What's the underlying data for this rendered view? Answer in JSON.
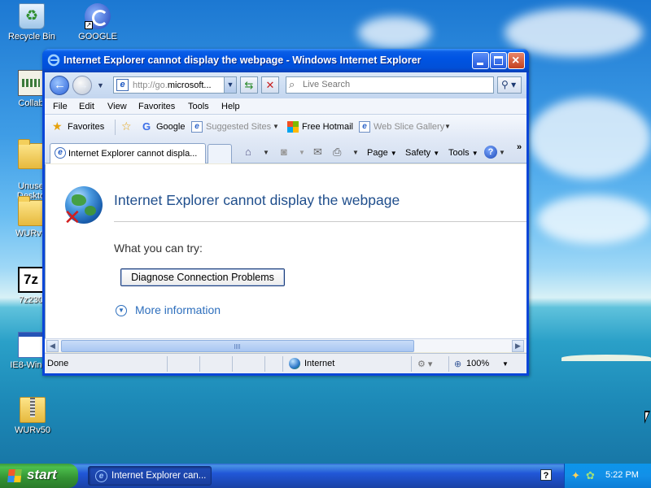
{
  "desktop": {
    "icons": [
      {
        "label": "Recycle Bin",
        "icon": "recycle-bin-icon"
      },
      {
        "label": "GOOGLE",
        "icon": "google-shortcut-icon"
      },
      {
        "label": "Collab",
        "icon": "collab-app-icon"
      },
      {
        "label": "Unuse\nDeskto",
        "icon": "folder-icon"
      },
      {
        "label": "WURv5",
        "icon": "folder-icon"
      },
      {
        "label": "7z230",
        "icon": "7zip-icon"
      },
      {
        "label": "IE8-Windo",
        "icon": "installer-icon"
      },
      {
        "label": "WURv50",
        "icon": "zip-folder-icon"
      }
    ]
  },
  "window": {
    "title": "Internet Explorer cannot display the webpage - Windows Internet Explorer",
    "buttons": {
      "minimize": "minimize-icon",
      "maximize": "maximize-icon",
      "close": "close-icon",
      "close_glyph": "×"
    },
    "address": {
      "url_prefix": "http://go.",
      "url_host": "microsoft...",
      "search_placeholder": "Live Search"
    },
    "menu": [
      "File",
      "Edit",
      "View",
      "Favorites",
      "Tools",
      "Help"
    ],
    "favorites_bar": {
      "favorites": "Favorites",
      "google": "Google",
      "suggested_sites": "Suggested Sites",
      "free_hotmail": "Free Hotmail",
      "web_slice_gallery": "Web Slice Gallery"
    },
    "tab": {
      "title": "Internet Explorer cannot displa..."
    },
    "command_bar": {
      "page": "Page",
      "safety": "Safety",
      "tools": "Tools",
      "more": "»"
    },
    "page": {
      "heading": "Internet Explorer cannot display the webpage",
      "try_label": "What you can try:",
      "diagnose_button": "Diagnose Connection Problems",
      "more_info": "More information"
    },
    "status": {
      "text": "Done",
      "zone": "Internet",
      "zoom": "100%"
    }
  },
  "taskbar": {
    "start": "start",
    "task_item": "Internet Explorer can...",
    "help": "?",
    "clock": "5:22 PM"
  },
  "colors": {
    "titlebar": "#0054e3",
    "heading": "#1f4e8c",
    "link": "#2e6fbd",
    "start": "#3c9b3c"
  }
}
